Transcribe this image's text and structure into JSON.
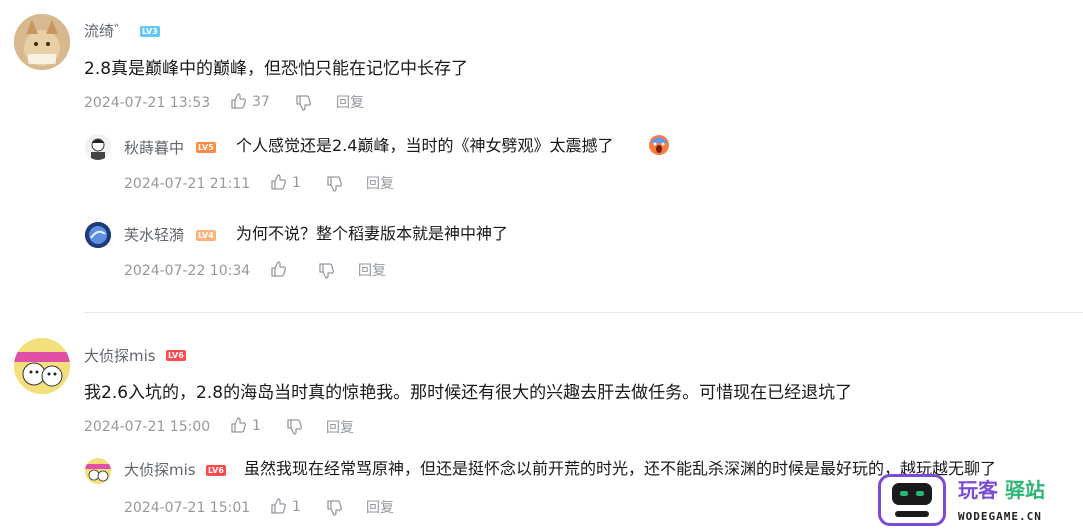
{
  "comments": [
    {
      "user": {
        "name": "流绮゛",
        "level": "LV3"
      },
      "text": "2.8真是巅峰中的巅峰，但恐怕只能在记忆中长存了",
      "time": "2024-07-21 13:53",
      "likes": "37",
      "reply_label": "回复",
      "replies": [
        {
          "user": {
            "name": "秋蒔暮中",
            "level": "LV5"
          },
          "text": "个人感觉还是2.4巅峰，当时的《神女劈观》太震撼了",
          "time": "2024-07-21 21:11",
          "likes": "1",
          "reply_label": "回复"
        },
        {
          "user": {
            "name": "芙水轻漪",
            "level": "LV4"
          },
          "text": "为何不说？整个稻妻版本就是神中神了",
          "time": "2024-07-22 10:34",
          "likes": "",
          "reply_label": "回复"
        }
      ]
    },
    {
      "user": {
        "name": "大侦探mis",
        "level": "LV6"
      },
      "text": "我2.6入坑的，2.8的海岛当时真的惊艳我。那时候还有很大的兴趣去肝去做任务。可惜现在已经退坑了",
      "time": "2024-07-21 15:00",
      "likes": "1",
      "reply_label": "回复",
      "replies": [
        {
          "user": {
            "name": "大侦探mis",
            "level": "LV6"
          },
          "text": "虽然我现在经常骂原神，但还是挺怀念以前开荒的时光，还不能乱杀深渊的时候是最好玩的，越玩越无聊了",
          "time": "2024-07-21 15:01",
          "likes": "1",
          "reply_label": "回复"
        }
      ]
    }
  ],
  "watermark": {
    "name_part1": "玩客",
    "name_part2": "驿站",
    "domain": "WODEGAME.CN"
  },
  "colors": {
    "lv3": "#61c9f7",
    "lv4": "#ffb27a",
    "lv5": "#ff8c42",
    "lv6": "#ff4a4a",
    "watermark_green": "#2bb673",
    "watermark_purple": "#7b4bd8"
  }
}
